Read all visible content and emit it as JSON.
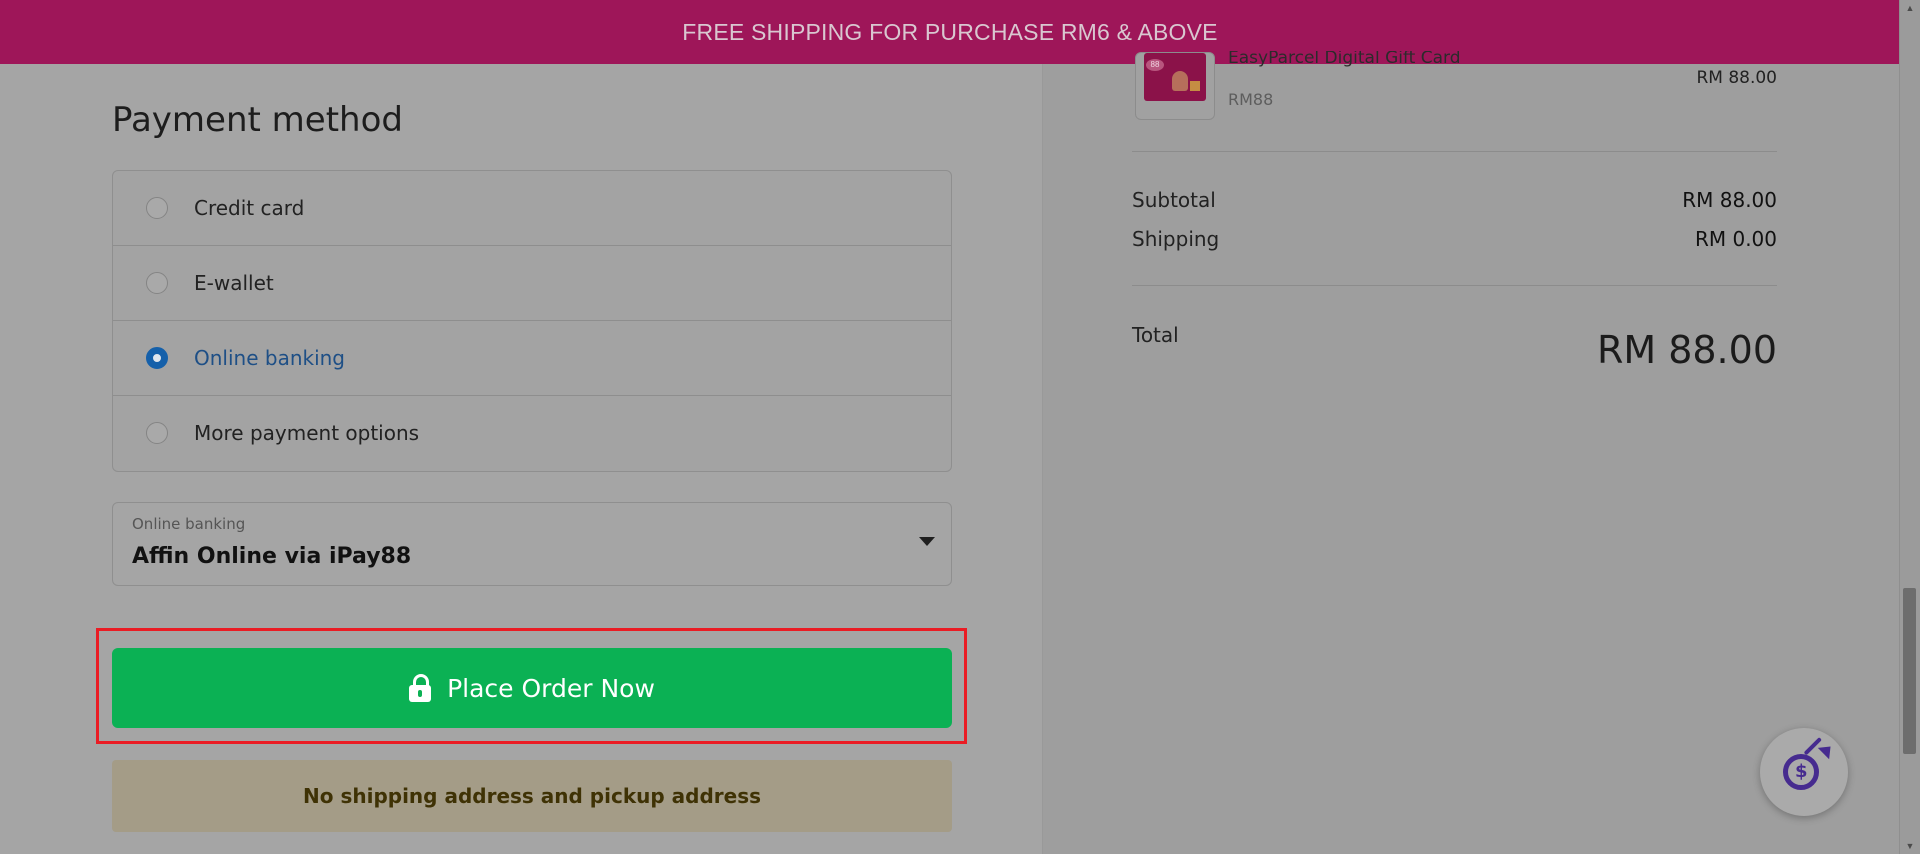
{
  "banner": {
    "text": "FREE SHIPPING FOR PURCHASE RM6 & ABOVE"
  },
  "payment": {
    "title": "Payment method",
    "options": [
      {
        "label": "Credit card",
        "selected": false
      },
      {
        "label": "E-wallet",
        "selected": false
      },
      {
        "label": "Online banking",
        "selected": true
      },
      {
        "label": "More payment options",
        "selected": false
      }
    ],
    "select": {
      "caption": "Online banking",
      "value": "Affin Online via iPay88"
    },
    "place_order_label": "Place Order Now",
    "warning": "No shipping address and pickup address"
  },
  "order": {
    "item": {
      "name": "EasyParcel Digital Gift Card",
      "variant": "RM88",
      "price": "RM 88.00",
      "image_badge": "88"
    },
    "subtotal_label": "Subtotal",
    "subtotal_value": "RM 88.00",
    "shipping_label": "Shipping",
    "shipping_value": "RM 0.00",
    "total_label": "Total",
    "total_value": "RM 88.00"
  },
  "icons": {
    "lock": "lock-icon",
    "floating": "target-dollar-icon",
    "dropdown": "caret-down-icon"
  },
  "colors": {
    "banner": "#9e1659",
    "selected_radio": "#1560aa",
    "place_order": "#0bb154",
    "highlight": "#ea1c24",
    "warning_text": "#3f3205"
  }
}
